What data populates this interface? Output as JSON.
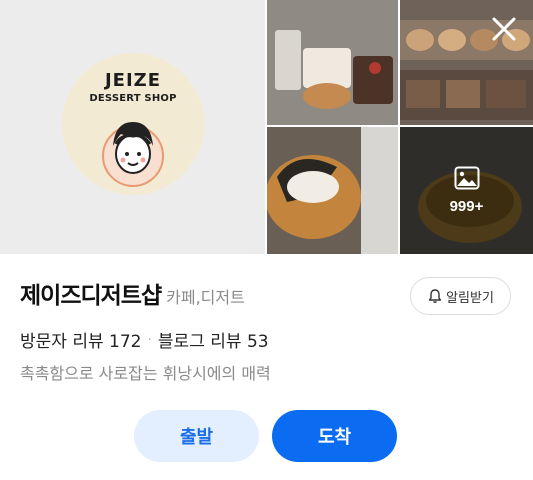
{
  "gallery": {
    "logo": {
      "title": "JEIZE",
      "subtitle": "DESSERT SHOP"
    },
    "more_count": "999+",
    "close_icon": "close-icon",
    "photo_icon": "image-icon"
  },
  "place": {
    "name": "제이즈디저트샵",
    "category": "카페,디저트",
    "visitor_reviews_label": "방문자 리뷰",
    "visitor_reviews_count": "172",
    "blog_reviews_label": "블로그 리뷰",
    "blog_reviews_count": "53",
    "description": "촉촉함으로 사로잡는 휘낭시에의 매력"
  },
  "alarm": {
    "label": "알림받기",
    "icon": "bell-icon"
  },
  "actions": {
    "depart_label": "출발",
    "arrive_label": "도착"
  },
  "colors": {
    "primary": "#0b6cf2",
    "depart_bg": "#e3effe",
    "muted": "#8a8a8a"
  }
}
